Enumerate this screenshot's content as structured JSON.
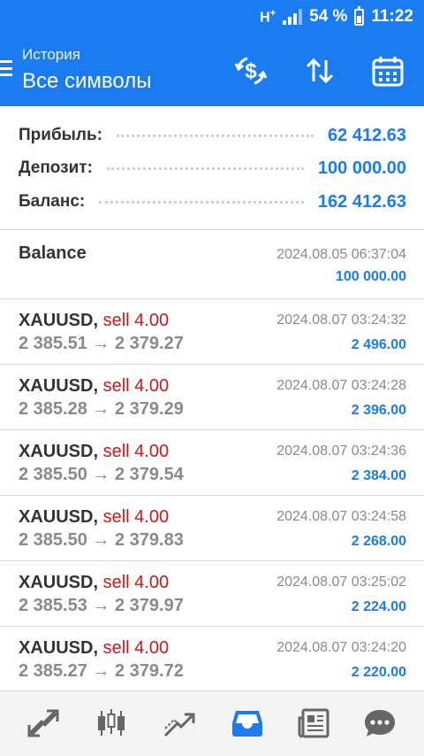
{
  "status_bar": {
    "network": "H",
    "network_sup": "+",
    "battery": "54 %",
    "time": "11:22"
  },
  "app_bar": {
    "subtitle": "История",
    "title": "Все символы"
  },
  "summary": [
    {
      "label": "Прибыль:",
      "value": "62 412.63"
    },
    {
      "label": "Депозит:",
      "value": "100 000.00"
    },
    {
      "label": "Баланс:",
      "value": "162 412.63"
    }
  ],
  "balance_entry": {
    "name": "Balance",
    "time": "2024.08.05 06:37:04",
    "amount": "100 000.00"
  },
  "deals": [
    {
      "symbol": "XAUUSD,",
      "side": "sell 4.00",
      "prices": "2 385.51 → 2 379.27",
      "time": "2024.08.07 03:24:32",
      "profit": "2 496.00"
    },
    {
      "symbol": "XAUUSD,",
      "side": "sell 4.00",
      "prices": "2 385.28 → 2 379.29",
      "time": "2024.08.07 03:24:28",
      "profit": "2 396.00"
    },
    {
      "symbol": "XAUUSD,",
      "side": "sell 4.00",
      "prices": "2 385.50 → 2 379.54",
      "time": "2024.08.07 03:24:36",
      "profit": "2 384.00"
    },
    {
      "symbol": "XAUUSD,",
      "side": "sell 4.00",
      "prices": "2 385.50 → 2 379.83",
      "time": "2024.08.07 03:24:58",
      "profit": "2 268.00"
    },
    {
      "symbol": "XAUUSD,",
      "side": "sell 4.00",
      "prices": "2 385.53 → 2 379.97",
      "time": "2024.08.07 03:25:02",
      "profit": "2 224.00"
    },
    {
      "symbol": "XAUUSD,",
      "side": "sell 4.00",
      "prices": "2 385.27 → 2 379.72",
      "time": "2024.08.07 03:24:20",
      "profit": "2 220.00"
    }
  ],
  "bottom_nav": [
    {
      "icon": "quotes-icon",
      "active": false
    },
    {
      "icon": "chart-icon",
      "active": false
    },
    {
      "icon": "trade-icon",
      "active": false
    },
    {
      "icon": "history-icon",
      "active": true
    },
    {
      "icon": "news-icon",
      "active": false
    },
    {
      "icon": "chat-icon",
      "active": false
    }
  ],
  "colors": {
    "accent": "#1a7cf0",
    "sell": "#d01818",
    "muted": "#8a8a8a",
    "text": "#333333",
    "nav_inactive": "#666666"
  }
}
